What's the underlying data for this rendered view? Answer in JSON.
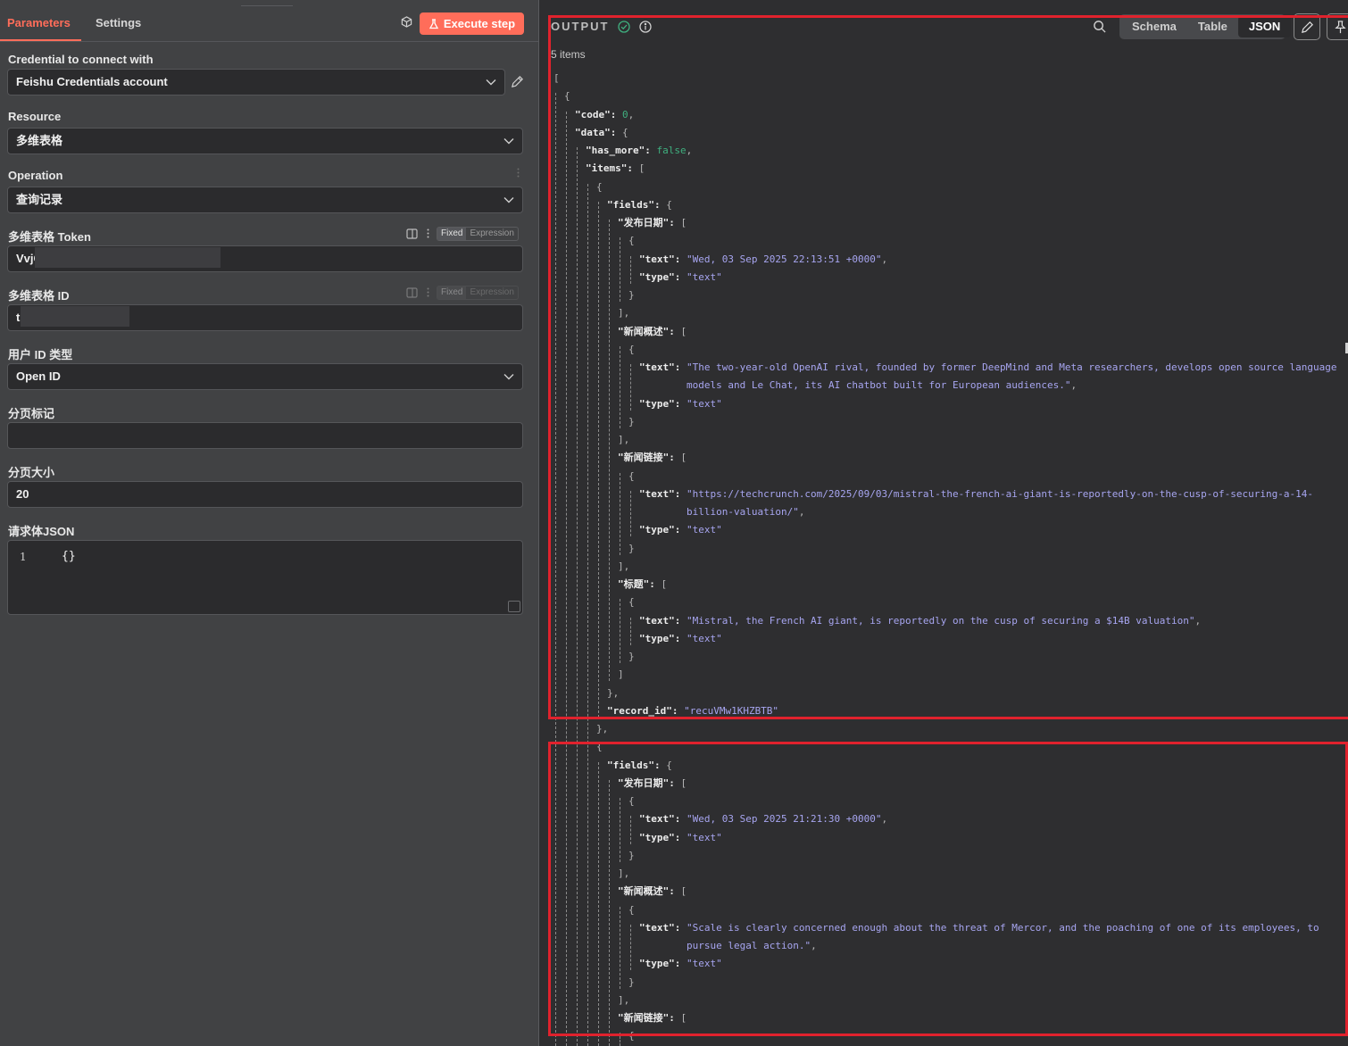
{
  "left": {
    "tabs": [
      {
        "label": "Parameters",
        "active": true
      },
      {
        "label": "Settings",
        "active": false
      }
    ],
    "execute_label": "Execute step",
    "fixed_label": "Fixed",
    "expression_label": "Expression",
    "credential": {
      "label": "Credential to connect with",
      "value": "Feishu Credentials account"
    },
    "resource": {
      "label": "Resource",
      "value": "多维表格"
    },
    "operation": {
      "label": "Operation",
      "value": "查询记录"
    },
    "token": {
      "label": "多维表格 Token",
      "value": "VvjC"
    },
    "table_id": {
      "label": "多维表格 ID",
      "value": "t"
    },
    "user_id_type": {
      "label": "用户 ID 类型",
      "value": "Open ID"
    },
    "page_token": {
      "label": "分页标记",
      "value": ""
    },
    "page_size": {
      "label": "分页大小",
      "value": "20"
    },
    "body_json": {
      "label": "请求体JSON",
      "line_number": "1",
      "code": "{}"
    }
  },
  "output": {
    "title": "OUTPUT",
    "items_count": "5 items",
    "views": [
      "Schema",
      "Table",
      "JSON"
    ],
    "active_view": "JSON",
    "json_lines": [
      {
        "indent": 0,
        "parts": [
          [
            "p",
            "["
          ]
        ]
      },
      {
        "indent": 1,
        "parts": [
          [
            "p",
            "{"
          ]
        ]
      },
      {
        "indent": 2,
        "parts": [
          [
            "k",
            "\"code\": "
          ],
          [
            "n",
            "0"
          ],
          [
            "p",
            ","
          ]
        ]
      },
      {
        "indent": 2,
        "parts": [
          [
            "k",
            "\"data\": "
          ],
          [
            "p",
            "{"
          ]
        ]
      },
      {
        "indent": 3,
        "parts": [
          [
            "k",
            "\"has_more\": "
          ],
          [
            "n",
            "false"
          ],
          [
            "p",
            ","
          ]
        ]
      },
      {
        "indent": 3,
        "parts": [
          [
            "k",
            "\"items\": "
          ],
          [
            "p",
            "["
          ]
        ]
      },
      {
        "indent": 4,
        "parts": [
          [
            "p",
            "{"
          ]
        ]
      },
      {
        "indent": 5,
        "parts": [
          [
            "k",
            "\"fields\": "
          ],
          [
            "p",
            "{"
          ]
        ]
      },
      {
        "indent": 6,
        "parts": [
          [
            "k",
            "\"发布日期\": "
          ],
          [
            "p",
            "["
          ]
        ]
      },
      {
        "indent": 7,
        "parts": [
          [
            "p",
            "{"
          ]
        ]
      },
      {
        "indent": 8,
        "parts": [
          [
            "k",
            "\"text\": "
          ],
          [
            "s",
            "\"Wed, 03 Sep 2025 22:13:51 +0000\""
          ],
          [
            "p",
            ","
          ]
        ]
      },
      {
        "indent": 8,
        "parts": [
          [
            "k",
            "\"type\": "
          ],
          [
            "s",
            "\"text\""
          ]
        ]
      },
      {
        "indent": 7,
        "parts": [
          [
            "p",
            "}"
          ]
        ]
      },
      {
        "indent": 6,
        "parts": [
          [
            "p",
            "],"
          ]
        ]
      },
      {
        "indent": 6,
        "parts": [
          [
            "k",
            "\"新闻概述\": "
          ],
          [
            "p",
            "["
          ]
        ]
      },
      {
        "indent": 7,
        "parts": [
          [
            "p",
            "{"
          ]
        ]
      },
      {
        "indent": 8,
        "parts": [
          [
            "k",
            "\"text\": "
          ],
          [
            "s",
            "\"The two-year-old OpenAI rival, founded by former DeepMind and Meta researchers, develops open source language"
          ]
        ]
      },
      {
        "indent": 8,
        "cont": true,
        "parts": [
          [
            "s",
            "models and Le Chat, its AI chatbot built for European audiences.\""
          ],
          [
            "p",
            ","
          ]
        ]
      },
      {
        "indent": 8,
        "parts": [
          [
            "k",
            "\"type\": "
          ],
          [
            "s",
            "\"text\""
          ]
        ]
      },
      {
        "indent": 7,
        "parts": [
          [
            "p",
            "}"
          ]
        ]
      },
      {
        "indent": 6,
        "parts": [
          [
            "p",
            "],"
          ]
        ]
      },
      {
        "indent": 6,
        "parts": [
          [
            "k",
            "\"新闻链接\": "
          ],
          [
            "p",
            "["
          ]
        ]
      },
      {
        "indent": 7,
        "parts": [
          [
            "p",
            "{"
          ]
        ]
      },
      {
        "indent": 8,
        "parts": [
          [
            "k",
            "\"text\": "
          ],
          [
            "s",
            "\"https://techcrunch.com/2025/09/03/mistral-the-french-ai-giant-is-reportedly-on-the-cusp-of-securing-a-14-"
          ]
        ]
      },
      {
        "indent": 8,
        "cont": true,
        "parts": [
          [
            "s",
            "billion-valuation/\""
          ],
          [
            "p",
            ","
          ]
        ]
      },
      {
        "indent": 8,
        "parts": [
          [
            "k",
            "\"type\": "
          ],
          [
            "s",
            "\"text\""
          ]
        ]
      },
      {
        "indent": 7,
        "parts": [
          [
            "p",
            "}"
          ]
        ]
      },
      {
        "indent": 6,
        "parts": [
          [
            "p",
            "],"
          ]
        ]
      },
      {
        "indent": 6,
        "parts": [
          [
            "k",
            "\"标题\": "
          ],
          [
            "p",
            "["
          ]
        ]
      },
      {
        "indent": 7,
        "parts": [
          [
            "p",
            "{"
          ]
        ]
      },
      {
        "indent": 8,
        "parts": [
          [
            "k",
            "\"text\": "
          ],
          [
            "s",
            "\"Mistral, the French AI giant, is reportedly on the cusp of securing a $14B valuation\""
          ],
          [
            "p",
            ","
          ]
        ]
      },
      {
        "indent": 8,
        "parts": [
          [
            "k",
            "\"type\": "
          ],
          [
            "s",
            "\"text\""
          ]
        ]
      },
      {
        "indent": 7,
        "parts": [
          [
            "p",
            "}"
          ]
        ]
      },
      {
        "indent": 6,
        "parts": [
          [
            "p",
            "]"
          ]
        ]
      },
      {
        "indent": 5,
        "parts": [
          [
            "p",
            "},"
          ]
        ]
      },
      {
        "indent": 5,
        "parts": [
          [
            "k",
            "\"record_id\": "
          ],
          [
            "s",
            "\"recuVMw1KHZBTB\""
          ]
        ]
      },
      {
        "indent": 4,
        "parts": [
          [
            "p",
            "},"
          ]
        ]
      },
      {
        "indent": 4,
        "parts": [
          [
            "p",
            "{"
          ]
        ]
      },
      {
        "indent": 5,
        "parts": [
          [
            "k",
            "\"fields\": "
          ],
          [
            "p",
            "{"
          ]
        ]
      },
      {
        "indent": 6,
        "parts": [
          [
            "k",
            "\"发布日期\": "
          ],
          [
            "p",
            "["
          ]
        ]
      },
      {
        "indent": 7,
        "parts": [
          [
            "p",
            "{"
          ]
        ]
      },
      {
        "indent": 8,
        "parts": [
          [
            "k",
            "\"text\": "
          ],
          [
            "s",
            "\"Wed, 03 Sep 2025 21:21:30 +0000\""
          ],
          [
            "p",
            ","
          ]
        ]
      },
      {
        "indent": 8,
        "parts": [
          [
            "k",
            "\"type\": "
          ],
          [
            "s",
            "\"text\""
          ]
        ]
      },
      {
        "indent": 7,
        "parts": [
          [
            "p",
            "}"
          ]
        ]
      },
      {
        "indent": 6,
        "parts": [
          [
            "p",
            "],"
          ]
        ]
      },
      {
        "indent": 6,
        "parts": [
          [
            "k",
            "\"新闻概述\": "
          ],
          [
            "p",
            "["
          ]
        ]
      },
      {
        "indent": 7,
        "parts": [
          [
            "p",
            "{"
          ]
        ]
      },
      {
        "indent": 8,
        "parts": [
          [
            "k",
            "\"text\": "
          ],
          [
            "s",
            "\"Scale is clearly concerned enough about the threat of Mercor, and the poaching of one of its employees, to"
          ]
        ]
      },
      {
        "indent": 8,
        "cont": true,
        "parts": [
          [
            "s",
            "pursue legal action.\""
          ],
          [
            "p",
            ","
          ]
        ]
      },
      {
        "indent": 8,
        "parts": [
          [
            "k",
            "\"type\": "
          ],
          [
            "s",
            "\"text\""
          ]
        ]
      },
      {
        "indent": 7,
        "parts": [
          [
            "p",
            "}"
          ]
        ]
      },
      {
        "indent": 6,
        "parts": [
          [
            "p",
            "],"
          ]
        ]
      },
      {
        "indent": 6,
        "parts": [
          [
            "k",
            "\"新闻链接\": "
          ],
          [
            "p",
            "["
          ]
        ]
      },
      {
        "indent": 7,
        "parts": [
          [
            "p",
            "{"
          ]
        ]
      }
    ]
  },
  "colors": {
    "accent": "#ff6d5a",
    "highlight": "#e0222d",
    "json_string": "#a7a5f0",
    "json_number": "#3fb07f"
  },
  "icons": [
    "cube-icon",
    "flask-icon",
    "pencil-icon",
    "chevron-down-icon",
    "panel-icon",
    "kebab-icon",
    "check-circle-icon",
    "info-icon",
    "search-icon",
    "pin-icon",
    "resize-icon"
  ]
}
